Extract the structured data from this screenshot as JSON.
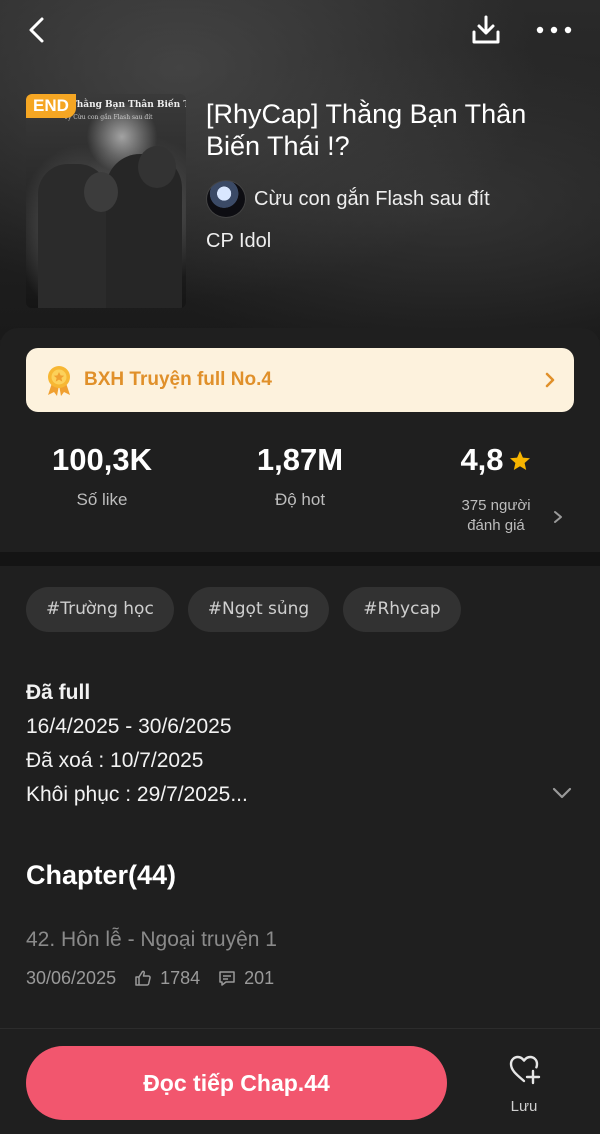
{
  "story": {
    "badge": "END",
    "title": "[RhyCap] Thằng Bạn Thân Biến Thái !?",
    "cover_title": "Thằng Bạn Thân Biến Thái !?",
    "cover_subtitle": "Tý Cừu con gắn Flash sau đít",
    "author": "Cừu con gắn Flash sau đít",
    "category": "CP Idol"
  },
  "ranking": {
    "label": "BXH Truyện full No.4"
  },
  "stats": {
    "likes_value": "100,3K",
    "likes_label": "Số like",
    "hot_value": "1,87M",
    "hot_label": "Độ hot",
    "rating_value": "4,8",
    "rating_label_line1": "375 người",
    "rating_label_line2": "đánh giá"
  },
  "tags": [
    "#Trường học",
    "#Ngọt sủng",
    "#Rhycap"
  ],
  "description": {
    "line1": "Đã full",
    "line2": "16/4/2025 - 30/6/2025",
    "line3": "Đã xoá : 10/7/2025",
    "line4": "Khôi phục : 29/7/2025..."
  },
  "chapters": {
    "heading": "Chapter(44)",
    "latest": {
      "title": "42. Hôn lễ - Ngoại truyện 1",
      "date": "30/06/2025",
      "likes": "1784",
      "comments": "201"
    }
  },
  "actions": {
    "read_label": "Đọc tiếp Chap.44",
    "save_label": "Lưu"
  },
  "colors": {
    "accent": "#f2566e",
    "rank_bg": "#fdf2dd",
    "rank_text": "#e0902a",
    "badge": "#f5a623",
    "star": "#f7b500"
  },
  "icons": {
    "back": "chevron-left-icon",
    "download": "download-icon",
    "more": "more-icon",
    "medal": "medal-icon",
    "star": "star-icon",
    "like": "thumbs-up-icon",
    "comment": "comment-icon",
    "save": "heart-plus-icon"
  }
}
